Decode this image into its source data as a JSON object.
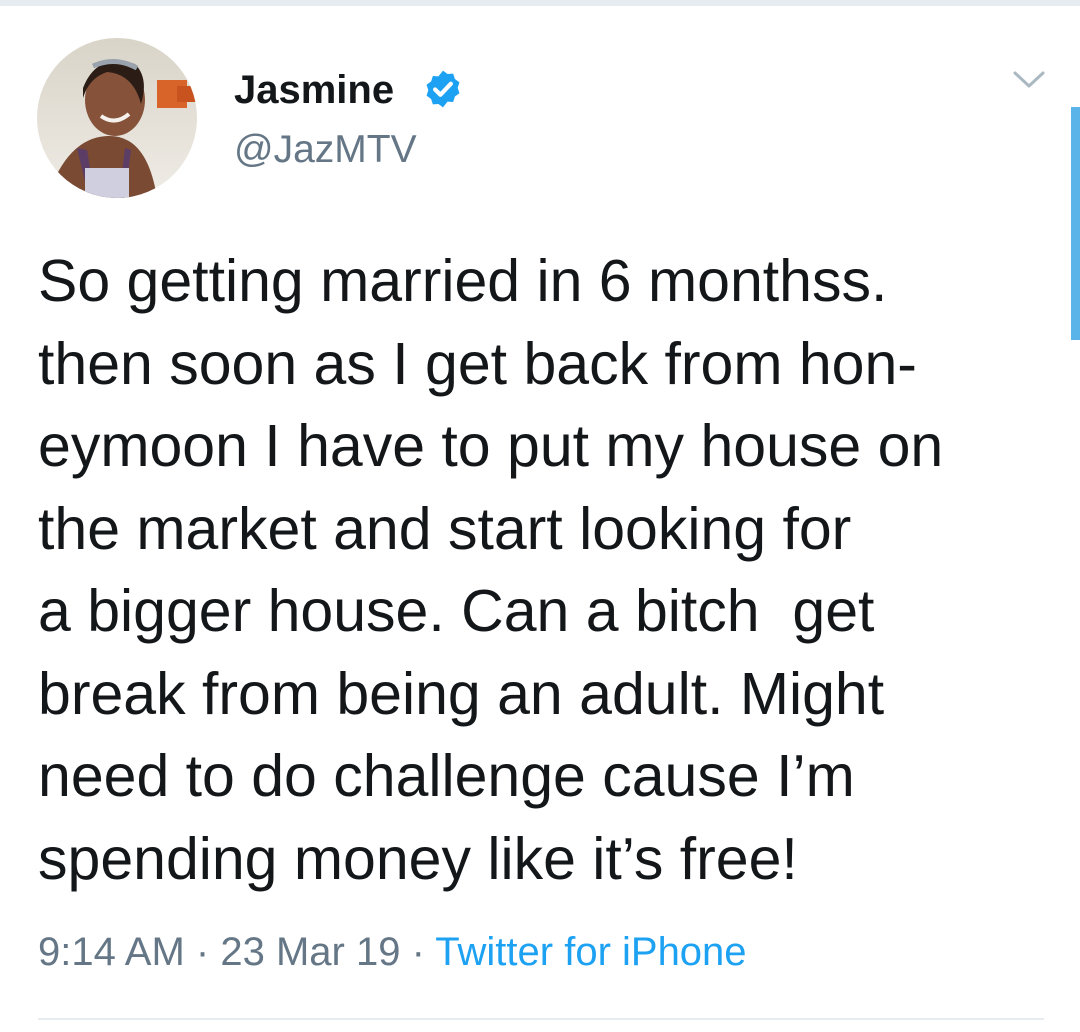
{
  "tweet": {
    "author": {
      "display_name": "Jasmine",
      "handle": "@JazMTV",
      "verified": true
    },
    "text_lines": [
      "So getting married in 6 monthss.",
      "then soon as I get back from hon-",
      "eymoon I have to put my house on",
      "the market and start looking for",
      "a bigger house. Can a bitch  get",
      "break from being an adult. Might",
      "need to do challenge cause I’m",
      "spending money like it’s free!"
    ],
    "time": "9:14 AM",
    "separator": "·",
    "date": "23 Mar 19",
    "source": "Twitter for iPhone"
  },
  "icons": {
    "verified": "verified-badge-icon",
    "menu": "chevron-down-icon"
  },
  "colors": {
    "accent": "#1da1f2",
    "text_primary": "#14171a",
    "text_secondary": "#657786",
    "divider": "#e6ecf0"
  }
}
